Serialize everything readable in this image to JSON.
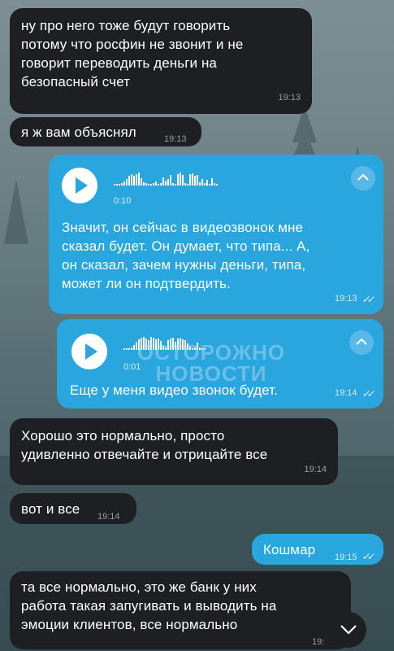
{
  "messages": [
    {
      "text": "ну про него тоже будут говорить\nпотому что росфин не звонит и не\nговорит переводить деньги на\nбезопасный счет",
      "time": "19:13"
    },
    {
      "text": "я ж вам объяснял",
      "time": "19:13"
    },
    {
      "duration": "0:10",
      "text": "Значит, он сейчас в видеозвонок мне\nсказал будет. Он думает, что типа... А,\nон сказал, зачем нужны деньги, типа,\nможет ли он подтвердить.",
      "time": "19:13"
    },
    {
      "duration": "0:01",
      "text": "Еще у меня видео звонок будет.",
      "time": "19:14"
    },
    {
      "text": "Хорошо это нормально, просто\nудивленно отвечайте и отрицайте все",
      "time": "19:14"
    },
    {
      "text": "вот и все",
      "time": "19:14"
    },
    {
      "text": "Кошмар",
      "time": "19:15"
    },
    {
      "text": "та все нормально, это же банк у них\nработа такая запугивать и выводить на\nэмоции клиентов, все нормально",
      "time": "19:"
    }
  ],
  "watermark": {
    "line1": "ОСТОРОЖНО",
    "line2": "НОВОСТИ"
  },
  "icons": {
    "play": "play-icon",
    "expand": "chevron-up-icon",
    "scroll": "chevron-down-icon",
    "read": "double-check-icon"
  },
  "colors": {
    "incoming": "#1e1f22",
    "outgoing": "#2aa6df"
  }
}
